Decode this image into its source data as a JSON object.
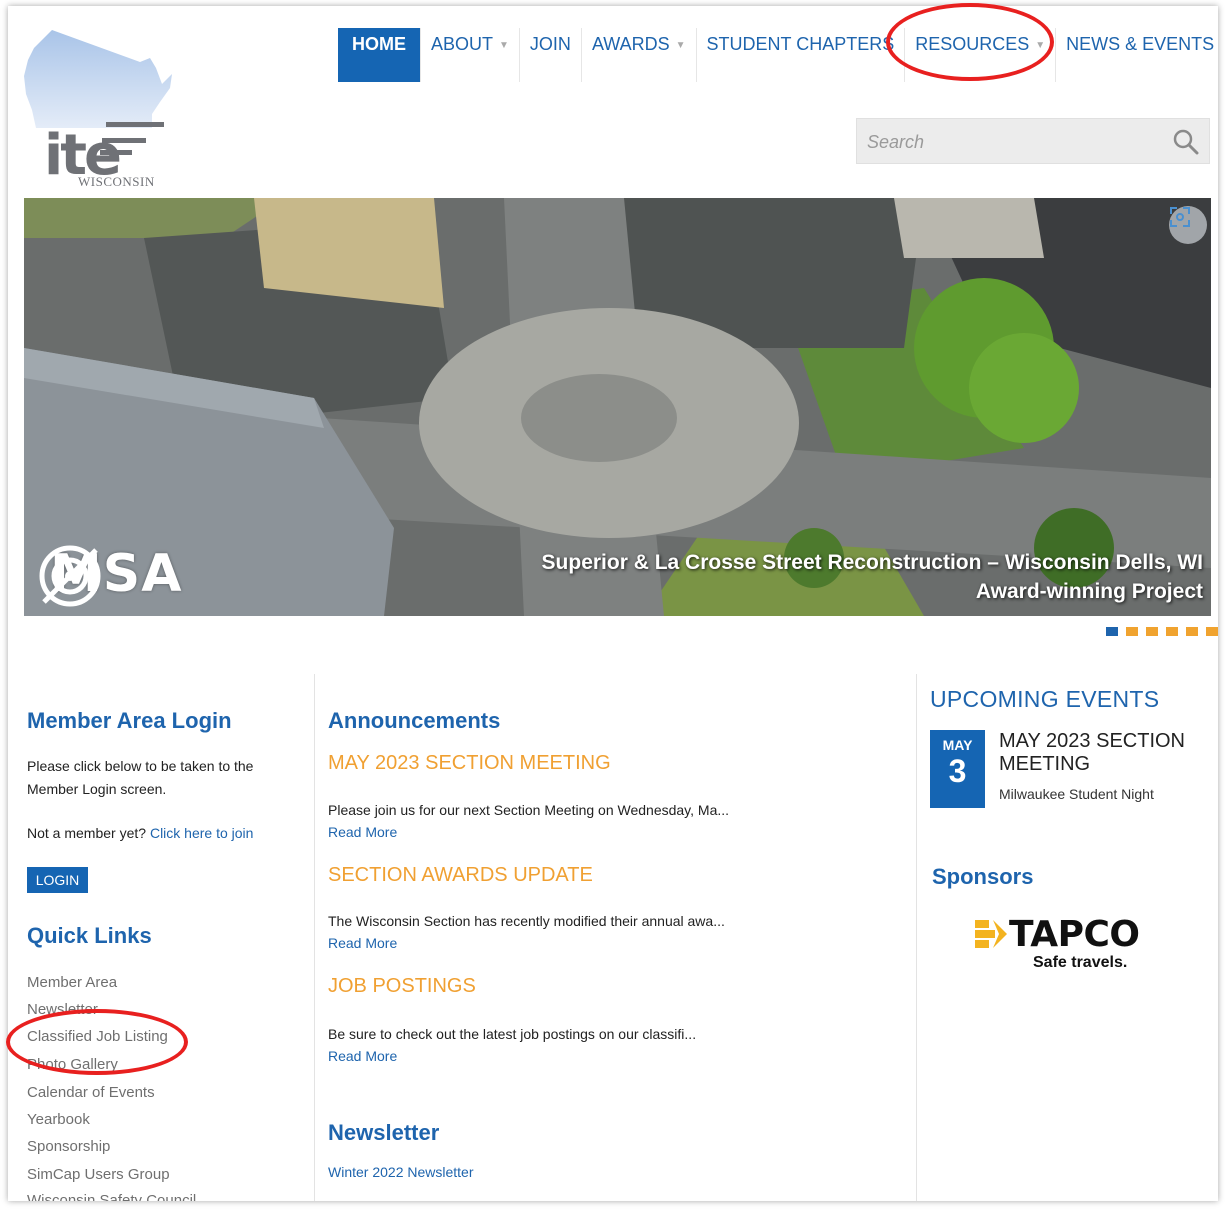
{
  "logo": {
    "main": "ite",
    "sub": "WISCONSIN"
  },
  "nav": {
    "items": [
      {
        "label": "HOME",
        "caret": false
      },
      {
        "label": "ABOUT",
        "caret": true
      },
      {
        "label": "JOIN",
        "caret": false
      },
      {
        "label": "AWARDS",
        "caret": true
      },
      {
        "label": "STUDENT CHAPTERS",
        "caret": false
      },
      {
        "label": "RESOURCES",
        "caret": true
      },
      {
        "label": "NEWS & EVENTS",
        "caret": true
      }
    ],
    "caret_glyph": "▼"
  },
  "search": {
    "placeholder": "Search"
  },
  "hero": {
    "logo_text": "MSA",
    "caption_line1": "Superior & La Crosse Street Reconstruction – Wisconsin Dells, WI",
    "caption_line2": "Award-winning Project",
    "slides": 7,
    "active_slide": 1
  },
  "member": {
    "title": "Member Area Login",
    "text1": "Please click below to be taken to the",
    "text2": "Member Login screen.",
    "not_member": "Not a member yet?",
    "join_link": "Click here to join",
    "login_button": "LOGIN"
  },
  "quick_links": {
    "title": "Quick Links",
    "items": [
      "Member Area",
      "Newsletter",
      "Classified Job Listing",
      "Photo Gallery",
      "Calendar of Events",
      "Yearbook",
      "Sponsorship",
      "SimCap Users Group",
      "Wisconsin Safety Council"
    ]
  },
  "announcements": {
    "title": "Announcements",
    "items": [
      {
        "title": "MAY 2023 SECTION MEETING",
        "body": "Please join us for our next Section Meeting on Wednesday, Ma...",
        "more": "Read More"
      },
      {
        "title": "SECTION AWARDS UPDATE",
        "body": "The Wisconsin Section has recently modified their annual awa...",
        "more": "Read More"
      },
      {
        "title": "JOB POSTINGS",
        "body": "Be sure to check out the latest job postings on our classifi...",
        "more": "Read More"
      }
    ]
  },
  "newsletter": {
    "title": "Newsletter",
    "link": "Winter 2022 Newsletter"
  },
  "events": {
    "title": "UPCOMING EVENTS",
    "month": "MAY",
    "day": "3",
    "event_title": "MAY 2023 SECTION MEETING",
    "event_sub": "Milwaukee Student Night"
  },
  "sponsors": {
    "title": "Sponsors",
    "name": "TAPCO",
    "tagline": "Safe travels."
  },
  "colors": {
    "brand_blue": "#1565b3",
    "link_blue": "#1e64ad",
    "accent_orange": "#f0a032",
    "annotation_red": "#e8201f"
  }
}
